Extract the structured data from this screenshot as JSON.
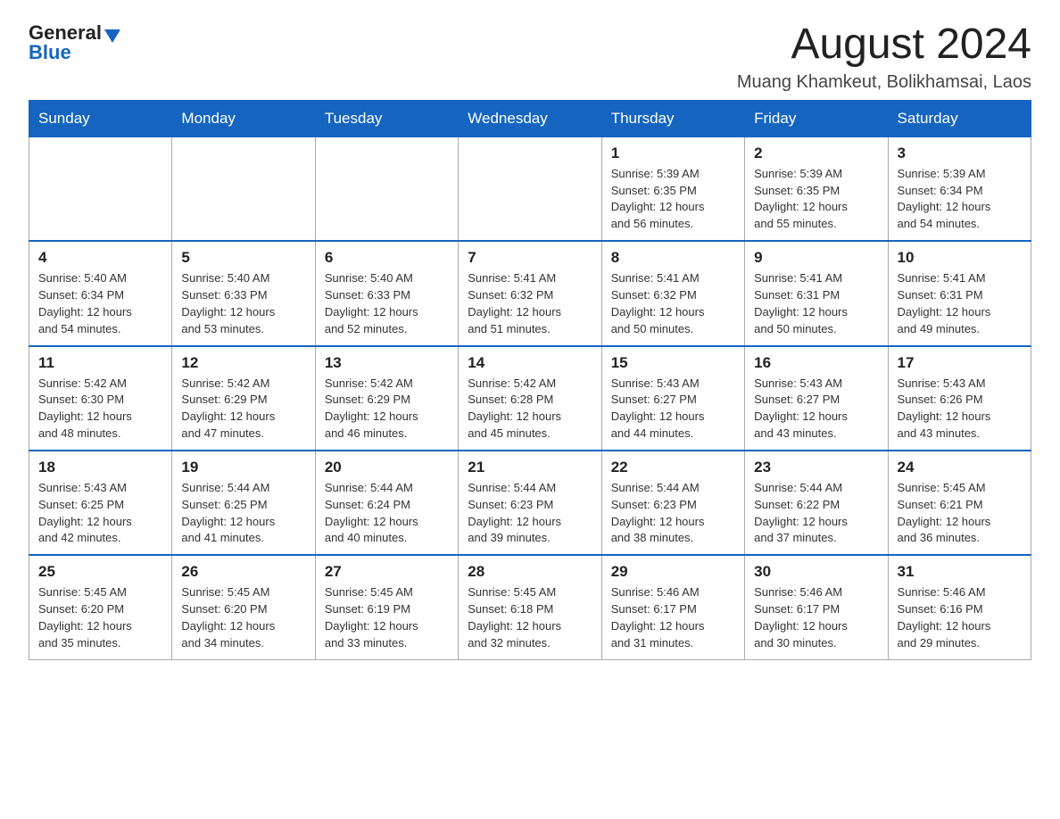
{
  "header": {
    "logo_general": "General",
    "logo_blue": "Blue",
    "month_title": "August 2024",
    "location": "Muang Khamkeut, Bolikhamsai, Laos"
  },
  "weekdays": [
    "Sunday",
    "Monday",
    "Tuesday",
    "Wednesday",
    "Thursday",
    "Friday",
    "Saturday"
  ],
  "weeks": [
    {
      "days": [
        {
          "num": "",
          "info": ""
        },
        {
          "num": "",
          "info": ""
        },
        {
          "num": "",
          "info": ""
        },
        {
          "num": "",
          "info": ""
        },
        {
          "num": "1",
          "info": "Sunrise: 5:39 AM\nSunset: 6:35 PM\nDaylight: 12 hours\nand 56 minutes."
        },
        {
          "num": "2",
          "info": "Sunrise: 5:39 AM\nSunset: 6:35 PM\nDaylight: 12 hours\nand 55 minutes."
        },
        {
          "num": "3",
          "info": "Sunrise: 5:39 AM\nSunset: 6:34 PM\nDaylight: 12 hours\nand 54 minutes."
        }
      ]
    },
    {
      "days": [
        {
          "num": "4",
          "info": "Sunrise: 5:40 AM\nSunset: 6:34 PM\nDaylight: 12 hours\nand 54 minutes."
        },
        {
          "num": "5",
          "info": "Sunrise: 5:40 AM\nSunset: 6:33 PM\nDaylight: 12 hours\nand 53 minutes."
        },
        {
          "num": "6",
          "info": "Sunrise: 5:40 AM\nSunset: 6:33 PM\nDaylight: 12 hours\nand 52 minutes."
        },
        {
          "num": "7",
          "info": "Sunrise: 5:41 AM\nSunset: 6:32 PM\nDaylight: 12 hours\nand 51 minutes."
        },
        {
          "num": "8",
          "info": "Sunrise: 5:41 AM\nSunset: 6:32 PM\nDaylight: 12 hours\nand 50 minutes."
        },
        {
          "num": "9",
          "info": "Sunrise: 5:41 AM\nSunset: 6:31 PM\nDaylight: 12 hours\nand 50 minutes."
        },
        {
          "num": "10",
          "info": "Sunrise: 5:41 AM\nSunset: 6:31 PM\nDaylight: 12 hours\nand 49 minutes."
        }
      ]
    },
    {
      "days": [
        {
          "num": "11",
          "info": "Sunrise: 5:42 AM\nSunset: 6:30 PM\nDaylight: 12 hours\nand 48 minutes."
        },
        {
          "num": "12",
          "info": "Sunrise: 5:42 AM\nSunset: 6:29 PM\nDaylight: 12 hours\nand 47 minutes."
        },
        {
          "num": "13",
          "info": "Sunrise: 5:42 AM\nSunset: 6:29 PM\nDaylight: 12 hours\nand 46 minutes."
        },
        {
          "num": "14",
          "info": "Sunrise: 5:42 AM\nSunset: 6:28 PM\nDaylight: 12 hours\nand 45 minutes."
        },
        {
          "num": "15",
          "info": "Sunrise: 5:43 AM\nSunset: 6:27 PM\nDaylight: 12 hours\nand 44 minutes."
        },
        {
          "num": "16",
          "info": "Sunrise: 5:43 AM\nSunset: 6:27 PM\nDaylight: 12 hours\nand 43 minutes."
        },
        {
          "num": "17",
          "info": "Sunrise: 5:43 AM\nSunset: 6:26 PM\nDaylight: 12 hours\nand 43 minutes."
        }
      ]
    },
    {
      "days": [
        {
          "num": "18",
          "info": "Sunrise: 5:43 AM\nSunset: 6:25 PM\nDaylight: 12 hours\nand 42 minutes."
        },
        {
          "num": "19",
          "info": "Sunrise: 5:44 AM\nSunset: 6:25 PM\nDaylight: 12 hours\nand 41 minutes."
        },
        {
          "num": "20",
          "info": "Sunrise: 5:44 AM\nSunset: 6:24 PM\nDaylight: 12 hours\nand 40 minutes."
        },
        {
          "num": "21",
          "info": "Sunrise: 5:44 AM\nSunset: 6:23 PM\nDaylight: 12 hours\nand 39 minutes."
        },
        {
          "num": "22",
          "info": "Sunrise: 5:44 AM\nSunset: 6:23 PM\nDaylight: 12 hours\nand 38 minutes."
        },
        {
          "num": "23",
          "info": "Sunrise: 5:44 AM\nSunset: 6:22 PM\nDaylight: 12 hours\nand 37 minutes."
        },
        {
          "num": "24",
          "info": "Sunrise: 5:45 AM\nSunset: 6:21 PM\nDaylight: 12 hours\nand 36 minutes."
        }
      ]
    },
    {
      "days": [
        {
          "num": "25",
          "info": "Sunrise: 5:45 AM\nSunset: 6:20 PM\nDaylight: 12 hours\nand 35 minutes."
        },
        {
          "num": "26",
          "info": "Sunrise: 5:45 AM\nSunset: 6:20 PM\nDaylight: 12 hours\nand 34 minutes."
        },
        {
          "num": "27",
          "info": "Sunrise: 5:45 AM\nSunset: 6:19 PM\nDaylight: 12 hours\nand 33 minutes."
        },
        {
          "num": "28",
          "info": "Sunrise: 5:45 AM\nSunset: 6:18 PM\nDaylight: 12 hours\nand 32 minutes."
        },
        {
          "num": "29",
          "info": "Sunrise: 5:46 AM\nSunset: 6:17 PM\nDaylight: 12 hours\nand 31 minutes."
        },
        {
          "num": "30",
          "info": "Sunrise: 5:46 AM\nSunset: 6:17 PM\nDaylight: 12 hours\nand 30 minutes."
        },
        {
          "num": "31",
          "info": "Sunrise: 5:46 AM\nSunset: 6:16 PM\nDaylight: 12 hours\nand 29 minutes."
        }
      ]
    }
  ]
}
